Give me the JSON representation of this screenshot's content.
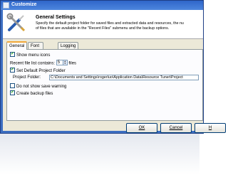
{
  "window": {
    "title": "Customize"
  },
  "header": {
    "title": "General Settings",
    "description_line1": "Specify the default project folder for saved files and extracted data and resources, the nu",
    "description_line2": "of files that are available in the \"Recent Files\" submenu and the backup options."
  },
  "tabs": [
    {
      "label": "General",
      "active": true
    },
    {
      "label": "Font and Color",
      "active": false
    },
    {
      "label": "Logging",
      "active": false
    }
  ],
  "general": {
    "show_menu_icons": {
      "label": "Show menu icons",
      "checked": true
    },
    "recent_files": {
      "label": "Recent file list contains:",
      "value": "5",
      "unit": "files"
    },
    "set_default_folder": {
      "label": "Set Default Project Folder",
      "checked": true
    },
    "project_folder": {
      "label": "Project Folder:",
      "value": "C:\\Documents and Settings\\rogerluo\\Application Data\\Resource Tuner\\Project"
    },
    "no_save_warning": {
      "label": "Do not show save warning",
      "checked": false
    },
    "create_backup": {
      "label": "Create backup files",
      "checked": true
    }
  },
  "buttons": {
    "ok": "OK",
    "cancel": "Cancel",
    "help": "H"
  },
  "colors": {
    "title_bar": "#3d6fc2",
    "dialog_face": "#ece9d8",
    "tab_accent": "#f1a737",
    "checkmark": "#21a121"
  },
  "icons": {
    "title": "customize-window-icon",
    "header": "screwdriver-wrench-icon",
    "checkbox": "checkmark-icon"
  }
}
